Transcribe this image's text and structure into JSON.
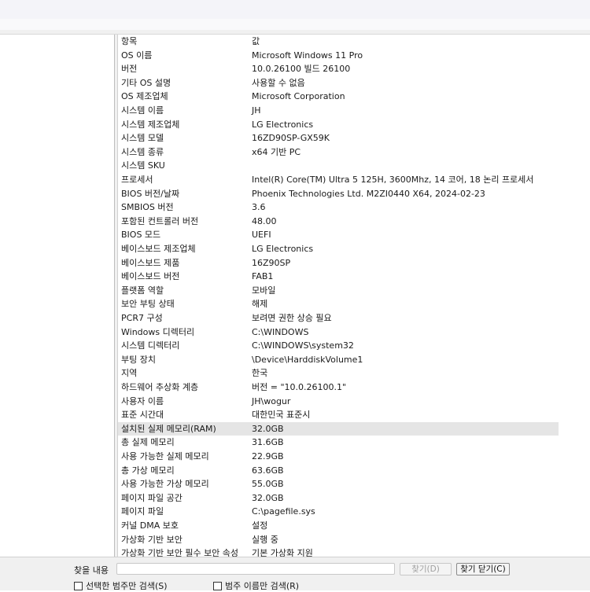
{
  "table": {
    "header": {
      "name": "항목",
      "value": "값"
    },
    "rows": [
      {
        "name": "OS 이름",
        "value": "Microsoft Windows 11 Pro"
      },
      {
        "name": "버전",
        "value": "10.0.26100 빌드 26100"
      },
      {
        "name": "기타 OS 설명",
        "value": "사용할 수 없음"
      },
      {
        "name": "OS 제조업체",
        "value": "Microsoft Corporation"
      },
      {
        "name": "시스템 이름",
        "value": "JH"
      },
      {
        "name": "시스템 제조업체",
        "value": "LG Electronics"
      },
      {
        "name": "시스템 모델",
        "value": "16ZD90SP-GX59K"
      },
      {
        "name": "시스템 종류",
        "value": "x64 기반 PC"
      },
      {
        "name": "시스템 SKU",
        "value": ""
      },
      {
        "name": "프로세서",
        "value": "Intel(R) Core(TM) Ultra 5 125H, 3600Mhz, 14 코어, 18 논리 프로세서"
      },
      {
        "name": "BIOS 버전/날짜",
        "value": "Phoenix Technologies Ltd. M2ZI0440 X64, 2024-02-23"
      },
      {
        "name": "SMBIOS 버전",
        "value": "3.6"
      },
      {
        "name": "포함된 컨트롤러 버전",
        "value": "48.00"
      },
      {
        "name": "BIOS 모드",
        "value": "UEFI"
      },
      {
        "name": "베이스보드 제조업체",
        "value": "LG Electronics"
      },
      {
        "name": "베이스보드 제품",
        "value": "16Z90SP"
      },
      {
        "name": "베이스보드 버전",
        "value": "FAB1"
      },
      {
        "name": "플랫폼 역할",
        "value": "모바일"
      },
      {
        "name": "보안 부팅 상태",
        "value": "해제"
      },
      {
        "name": "PCR7 구성",
        "value": "보려면 권한 상승 필요"
      },
      {
        "name": "Windows 디렉터리",
        "value": "C:\\WINDOWS"
      },
      {
        "name": "시스템 디렉터리",
        "value": "C:\\WINDOWS\\system32"
      },
      {
        "name": "부팅 장치",
        "value": "\\Device\\HarddiskVolume1"
      },
      {
        "name": "지역",
        "value": "한국"
      },
      {
        "name": "하드웨어 추상화 계층",
        "value": "버전 = \"10.0.26100.1\""
      },
      {
        "name": "사용자 이름",
        "value": "JH\\wogur"
      },
      {
        "name": "표준 시간대",
        "value": "대한민국 표준시"
      },
      {
        "name": "설치된 실제 메모리(RAM)",
        "value": "32.0GB",
        "selected": true
      },
      {
        "name": "총 실제 메모리",
        "value": "31.6GB"
      },
      {
        "name": "사용 가능한 실제 메모리",
        "value": "22.9GB"
      },
      {
        "name": "총 가상 메모리",
        "value": "63.6GB"
      },
      {
        "name": "사용 가능한 가상 메모리",
        "value": "55.0GB"
      },
      {
        "name": "페이지 파일 공간",
        "value": "32.0GB"
      },
      {
        "name": "페이지 파일",
        "value": "C:\\pagefile.sys"
      },
      {
        "name": "커널 DMA 보호",
        "value": "설정"
      },
      {
        "name": "가상화 기반 보안",
        "value": "실행 중"
      },
      {
        "name": "가상화 기반 보안 필수 보안 속성",
        "value": "기본 가상화 지원"
      }
    ]
  },
  "findbar": {
    "label": "찾을 내용",
    "input_value": "",
    "find_button": "찾기(D)",
    "close_button": "찾기 닫기(C)",
    "checkbox_selected_only": "선택한 범주만 검색(S)",
    "checkbox_category_names": "범주 이름만 검색(R)"
  }
}
